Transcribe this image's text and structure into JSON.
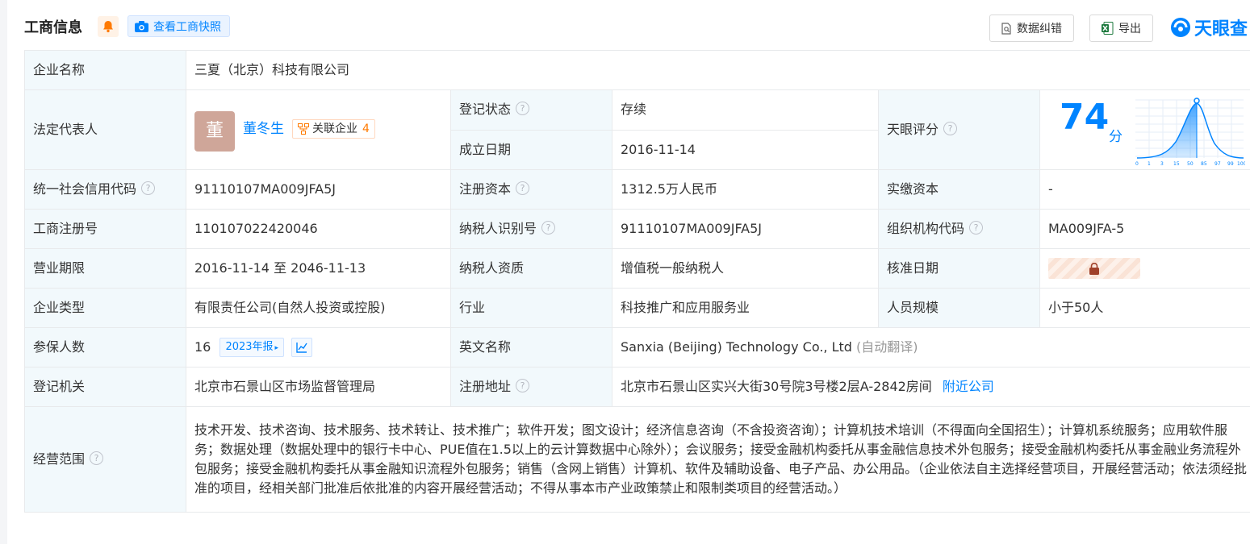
{
  "header": {
    "title": "工商信息",
    "snapshot_label": "查看工商快照",
    "report_error_label": "数据纠错",
    "export_label": "导出",
    "logo_text": "天眼查"
  },
  "fields": {
    "company_name": {
      "label": "企业名称",
      "value": "三夏（北京）科技有限公司"
    },
    "legal_rep": {
      "label": "法定代表人",
      "avatar_char": "董",
      "name": "董冬生",
      "related_label": "关联企业",
      "related_count": "4"
    },
    "reg_status": {
      "label": "登记状态",
      "value": "存续"
    },
    "established": {
      "label": "成立日期",
      "value": "2016-11-14"
    },
    "tianyan_score": {
      "label": "天眼评分",
      "score": "74",
      "unit": "分",
      "axis_ticks": [
        "0",
        "1",
        "3",
        "15",
        "50",
        "85",
        "97",
        "99",
        "100"
      ]
    },
    "credit_code": {
      "label": "统一社会信用代码",
      "value": "91110107MA009JFA5J"
    },
    "reg_capital": {
      "label": "注册资本",
      "value": "1312.5万人民币"
    },
    "paid_capital": {
      "label": "实缴资本",
      "value": "-"
    },
    "reg_number": {
      "label": "工商注册号",
      "value": "110107022420046"
    },
    "tax_id": {
      "label": "纳税人识别号",
      "value": "91110107MA009JFA5J"
    },
    "org_code": {
      "label": "组织机构代码",
      "value": "MA009JFA-5"
    },
    "business_term": {
      "label": "营业期限",
      "value": "2016-11-14 至 2046-11-13"
    },
    "taxpayer_quality": {
      "label": "纳税人资质",
      "value": "增值税一般纳税人"
    },
    "approval_date": {
      "label": "核准日期"
    },
    "company_type": {
      "label": "企业类型",
      "value": "有限责任公司(自然人投资或控股)"
    },
    "industry": {
      "label": "行业",
      "value": "科技推广和应用服务业"
    },
    "staff_size": {
      "label": "人员规模",
      "value": "小于50人"
    },
    "insured": {
      "label": "参保人数",
      "value": "16",
      "year_tag": "2023年报"
    },
    "english_name": {
      "label": "英文名称",
      "value": "Sanxia (Beijing) Technology Co., Ltd",
      "note": "(自动翻译)"
    },
    "reg_authority": {
      "label": "登记机关",
      "value": "北京市石景山区市场监督管理局"
    },
    "reg_address": {
      "label": "注册地址",
      "value": "北京市石景山区实兴大街30号院3号楼2层A-2842房间",
      "link": "附近公司"
    },
    "business_scope": {
      "label": "经营范围",
      "value": "技术开发、技术咨询、技术服务、技术转让、技术推广；软件开发；图文设计；经济信息咨询（不含投资咨询）；计算机技术培训（不得面向全国招生）；计算机系统服务；应用软件服务；数据处理（数据处理中的银行卡中心、PUE值在1.5以上的云计算数据中心除外）；会议服务；接受金融机构委托从事金融信息技术外包服务；接受金融机构委托从事金融业务流程外包服务；接受金融机构委托从事金融知识流程外包服务；销售（含网上销售）计算机、软件及辅助设备、电子产品、办公用品。（企业依法自主选择经营项目，开展经营活动；依法须经批准的项目，经相关部门批准后依批准的内容开展经营活动；不得从事本市产业政策禁止和限制类项目的经营活动。）"
    }
  },
  "colors": {
    "accent": "#0084ff",
    "label_bg": "#f2f9fc",
    "status_green": "#00a854",
    "badge_orange": "#ff7a00"
  }
}
